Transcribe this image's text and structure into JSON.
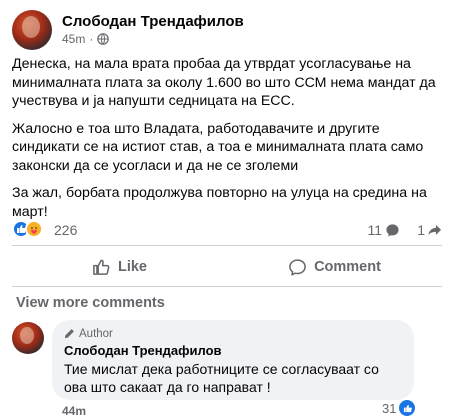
{
  "post": {
    "author": "Слободан Трендафилов",
    "time": "45m",
    "separator": "·",
    "paragraphs": [
      "Денеска, на мала врата пробаа да утврдат усогласување на минималната плата за околу 1.600 во што ССМ нема мандат да учествува и ја напушти седницата на ЕСС.",
      "Жалосно е тоа што Владата, работодавачите и другите синдикати се на истиот став, а тоа е минималната плата само законски да се усогласи и да не се зголеми",
      "За жал, борбата продолжува повторно на улуца на средина на март!"
    ]
  },
  "stats": {
    "reactions": "226",
    "comments": "11",
    "shares": "1"
  },
  "actions": {
    "like": "Like",
    "comment": "Comment"
  },
  "comments_section": {
    "view_more": "View more comments",
    "comment": {
      "badge": "Author",
      "name": "Слободан Трендафилов",
      "text": "Тие мислат дека работниците се согласуваат со ова што сакаат да го направат !",
      "time": "44m",
      "likes": "31"
    }
  },
  "colors": {
    "accent": "#1b74e4",
    "secondary_text": "#65676b",
    "bubble": "#f0f2f5"
  }
}
